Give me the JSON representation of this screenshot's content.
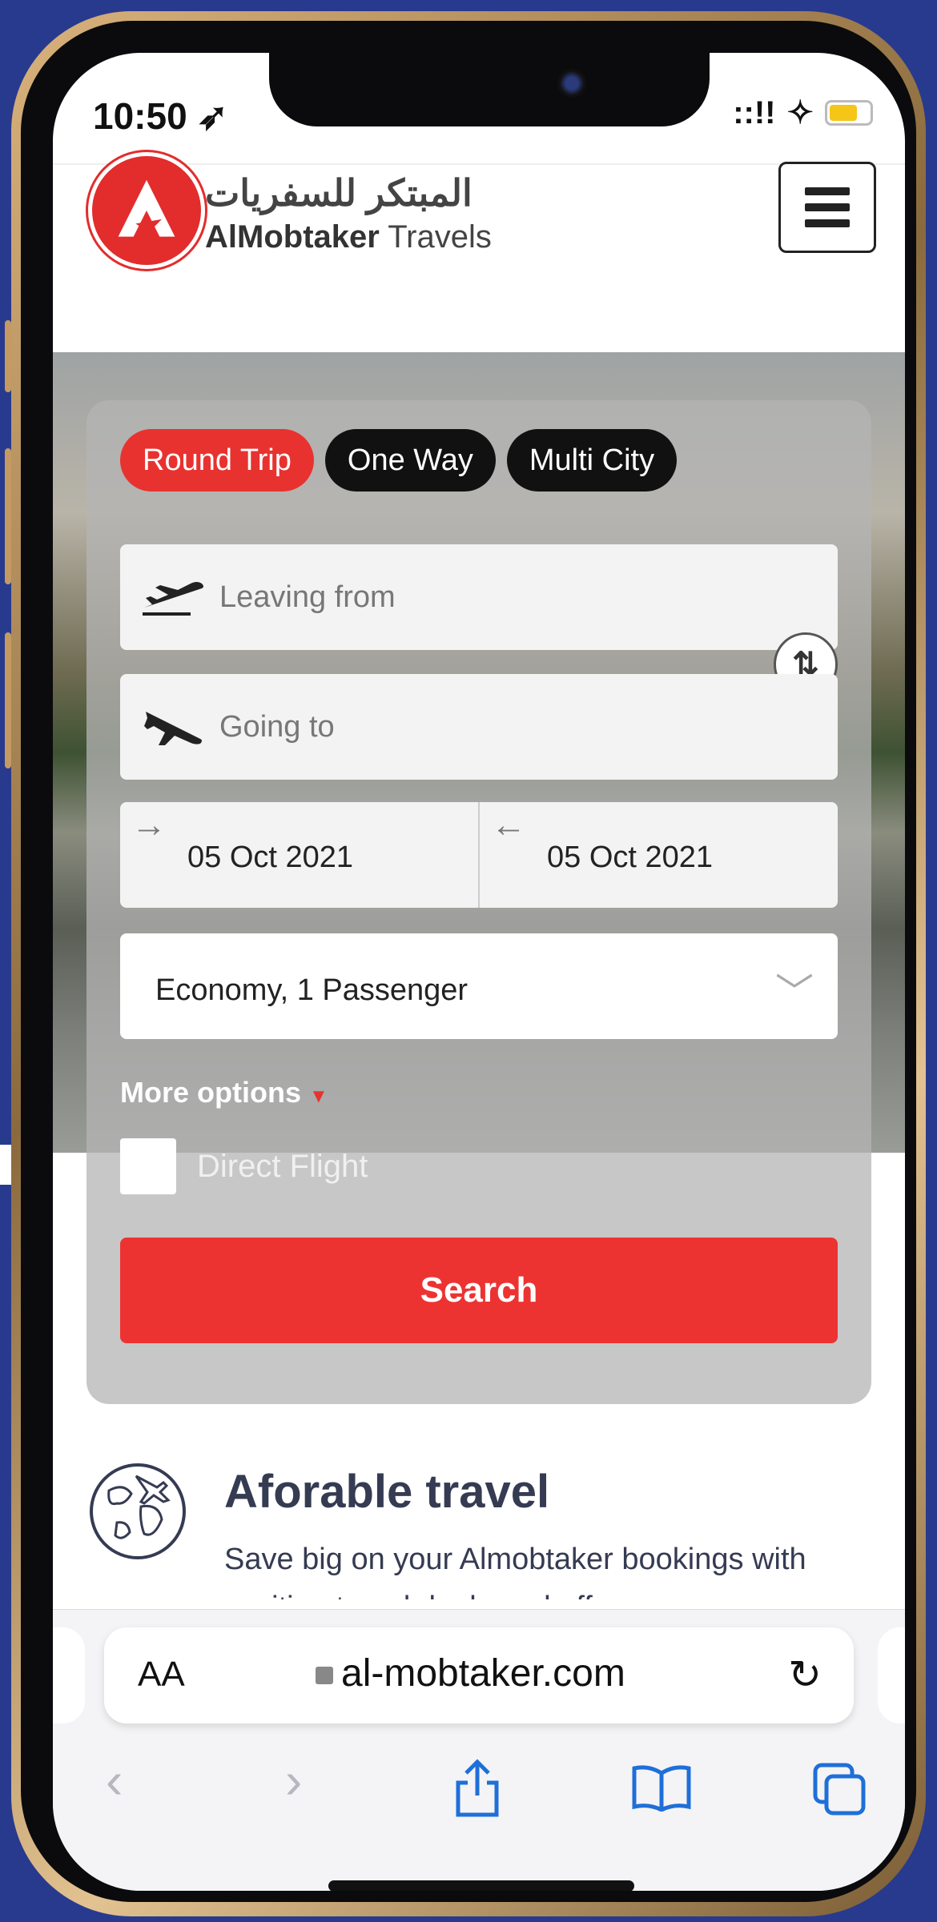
{
  "status_bar": {
    "time": "10:50 ➶",
    "signal": "::!!",
    "wifi": "✧"
  },
  "header": {
    "logo_arabic": "المبتكر للسفريات",
    "logo_en_bold": "AlMobtaker",
    "logo_en_light": " Travels"
  },
  "search_card": {
    "tabs": [
      "Round Trip",
      "One Way",
      "Multi City"
    ],
    "active_tab": "Round Trip",
    "leaving_from_placeholder": "Leaving from",
    "going_to_placeholder": "Going to",
    "depart_date": "05 Oct 2021",
    "return_date": "05 Oct 2021",
    "cabin": "Economy, 1 Passenger",
    "more_options": "More options",
    "direct_flight": "Direct Flight",
    "search_label": "Search"
  },
  "feature": {
    "title": "Aforable travel",
    "text": "Save big on your Almobtaker bookings with exciting travel deals and offers"
  },
  "browser": {
    "aa_label": "AA",
    "url": "al-mobtaker.com"
  },
  "colors": {
    "accent_red": "#e8322f",
    "background_blue": "#283a8e",
    "text_dark": "#353b52",
    "ios_blue": "#1f6fd8"
  }
}
